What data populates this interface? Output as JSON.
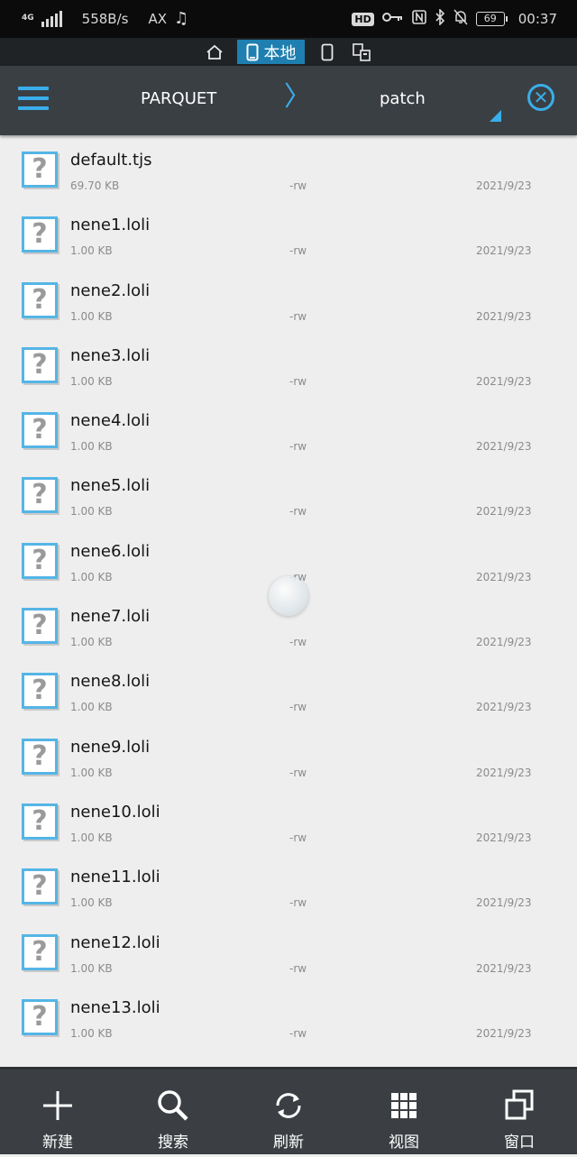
{
  "status_bar": {
    "network": "4G",
    "speed": "558B/s",
    "carrier_badge": "AX",
    "hd_badge": "HD",
    "battery": "69",
    "time": "00:37"
  },
  "location_tabs": [
    {
      "label": "",
      "icon": "home-icon",
      "active": false
    },
    {
      "label": "本地",
      "icon": "phone-icon",
      "active": true
    },
    {
      "label": "",
      "icon": "device-icon",
      "active": false
    },
    {
      "label": "",
      "icon": "network-devices-icon",
      "active": false
    }
  ],
  "toolbar": {
    "breadcrumb_parent": "PARQUET",
    "breadcrumb_current": "patch"
  },
  "files": [
    {
      "name": "default.tjs",
      "size": "69.70 KB",
      "perm": "-rw",
      "date": "2021/9/23"
    },
    {
      "name": "nene1.loli",
      "size": "1.00 KB",
      "perm": "-rw",
      "date": "2021/9/23"
    },
    {
      "name": "nene2.loli",
      "size": "1.00 KB",
      "perm": "-rw",
      "date": "2021/9/23"
    },
    {
      "name": "nene3.loli",
      "size": "1.00 KB",
      "perm": "-rw",
      "date": "2021/9/23"
    },
    {
      "name": "nene4.loli",
      "size": "1.00 KB",
      "perm": "-rw",
      "date": "2021/9/23"
    },
    {
      "name": "nene5.loli",
      "size": "1.00 KB",
      "perm": "-rw",
      "date": "2021/9/23"
    },
    {
      "name": "nene6.loli",
      "size": "1.00 KB",
      "perm": "-rw",
      "date": "2021/9/23"
    },
    {
      "name": "nene7.loli",
      "size": "1.00 KB",
      "perm": "-rw",
      "date": "2021/9/23"
    },
    {
      "name": "nene8.loli",
      "size": "1.00 KB",
      "perm": "-rw",
      "date": "2021/9/23"
    },
    {
      "name": "nene9.loli",
      "size": "1.00 KB",
      "perm": "-rw",
      "date": "2021/9/23"
    },
    {
      "name": "nene10.loli",
      "size": "1.00 KB",
      "perm": "-rw",
      "date": "2021/9/23"
    },
    {
      "name": "nene11.loli",
      "size": "1.00 KB",
      "perm": "-rw",
      "date": "2021/9/23"
    },
    {
      "name": "nene12.loli",
      "size": "1.00 KB",
      "perm": "-rw",
      "date": "2021/9/23"
    },
    {
      "name": "nene13.loli",
      "size": "1.00 KB",
      "perm": "-rw",
      "date": "2021/9/23"
    }
  ],
  "bottom_bar": [
    {
      "label": "新建",
      "icon": "plus-icon"
    },
    {
      "label": "搜索",
      "icon": "search-icon"
    },
    {
      "label": "刷新",
      "icon": "refresh-icon"
    },
    {
      "label": "视图",
      "icon": "grid-view-icon"
    },
    {
      "label": "窗口",
      "icon": "windows-icon"
    }
  ],
  "colors": {
    "accent": "#3aaeea",
    "active_tab": "#1e7fb0",
    "toolbar": "#3a3f44",
    "bottom_bar": "#3b3f43",
    "list_bg": "#eeeeee"
  }
}
